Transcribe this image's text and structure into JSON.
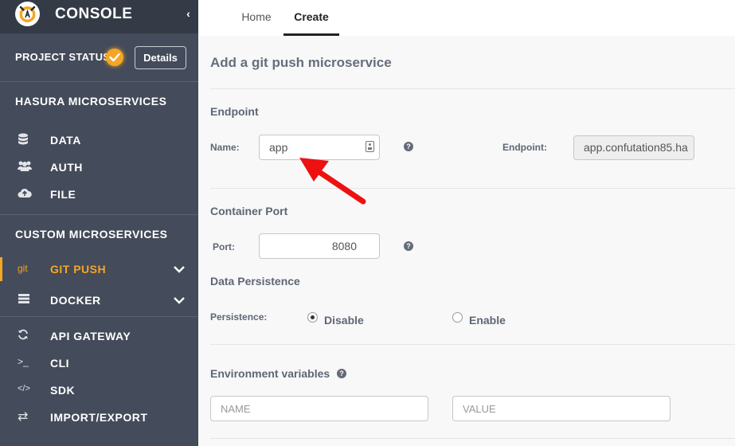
{
  "sidebar": {
    "brand": "CONSOLE",
    "collapse_glyph": "‹",
    "project_status_label": "PROJECT STATUS:",
    "details_label": "Details",
    "hasura_section": "HASURA MICROSERVICES",
    "custom_section": "CUSTOM MICROSERVICES",
    "items": [
      {
        "label": "DATA",
        "icon": "database-icon"
      },
      {
        "label": "AUTH",
        "icon": "users-icon"
      },
      {
        "label": "FILE",
        "icon": "cloud-upload-icon"
      },
      {
        "label": "GIT PUSH",
        "icon": "git-icon",
        "icon_text": "git",
        "active": true
      },
      {
        "label": "DOCKER",
        "icon": "server-icon"
      },
      {
        "label": "API GATEWAY",
        "icon": "refresh-icon"
      },
      {
        "label": "CLI",
        "icon": "terminal-icon",
        "icon_text": ">_"
      },
      {
        "label": "SDK",
        "icon": "code-icon",
        "icon_text": "</>"
      },
      {
        "label": "IMPORT/EXPORT",
        "icon": "exchange-icon",
        "icon_text": "⇄"
      }
    ]
  },
  "tabs": [
    {
      "label": "Home",
      "active": false
    },
    {
      "label": "Create",
      "active": true
    }
  ],
  "main": {
    "title": "Add a git push microservice",
    "endpoint_section": "Endpoint",
    "name_label": "Name:",
    "name_value": "app",
    "endpoint_label": "Endpoint:",
    "endpoint_value": "app.confutation85.ha",
    "container_port_section": "Container Port",
    "port_label": "Port:",
    "port_value": "8080",
    "data_persistence_section": "Data Persistence",
    "persistence_label": "Persistence:",
    "persistence_options": [
      {
        "label": "Disable",
        "checked": true
      },
      {
        "label": "Enable",
        "checked": false
      }
    ],
    "env_section": "Environment variables",
    "env_name_placeholder": "NAME",
    "env_value_placeholder": "VALUE",
    "help_glyph": "?"
  },
  "colors": {
    "sidebar_bg": "#444b5a",
    "accent": "#f5a623",
    "arrow": "#ee1111"
  }
}
